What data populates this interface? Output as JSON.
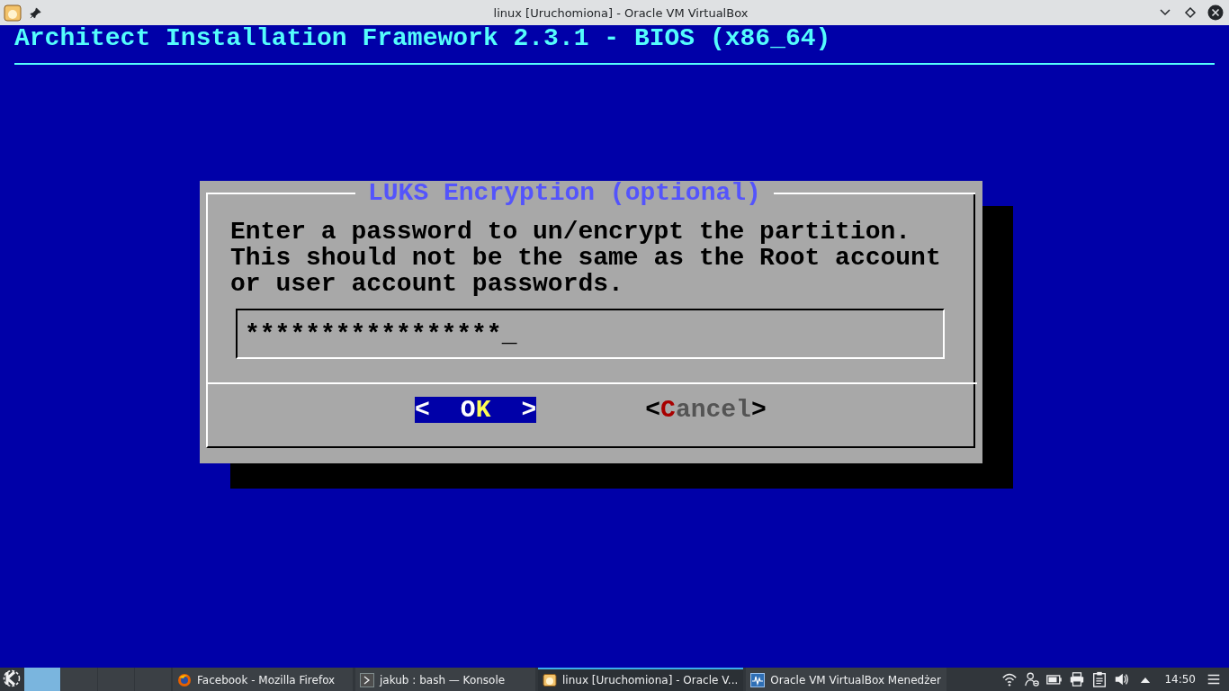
{
  "window": {
    "title": "linux [Uruchomiona] - Oracle VM VirtualBox"
  },
  "console": {
    "header": "Architect Installation Framework 2.3.1 - BIOS (x86_64)",
    "dialog": {
      "title": "LUKS Encryption (optional)",
      "message": [
        "Enter a password to un/encrypt the partition.",
        "This should not be the same as the Root account",
        "or user account passwords."
      ],
      "password": {
        "value": "*****************",
        "cursor": "_"
      },
      "buttons": [
        {
          "left": "<",
          "before": "O",
          "hotkey": "K",
          "right": ">",
          "selected": true
        },
        {
          "left": "<",
          "hotkey": "C",
          "after": "ancel",
          "right": ">",
          "selected": false
        }
      ]
    }
  },
  "taskbar": {
    "desktops": [
      {
        "selected": true
      },
      {
        "selected": false
      },
      {
        "selected": false
      },
      {
        "selected": false
      }
    ],
    "tasks": [
      {
        "kind": "firefox",
        "label": "Facebook - Mozilla Firefox",
        "selected": false
      },
      {
        "kind": "terminal",
        "label": "jakub : bash — Konsole",
        "selected": false
      },
      {
        "kind": "vm",
        "label": "linux [Uruchomiona] - Oracle V...",
        "selected": true
      },
      {
        "kind": "manager",
        "label": "Oracle VM VirtualBox Menedżer",
        "selected": false
      }
    ],
    "clock": "14:50"
  }
}
